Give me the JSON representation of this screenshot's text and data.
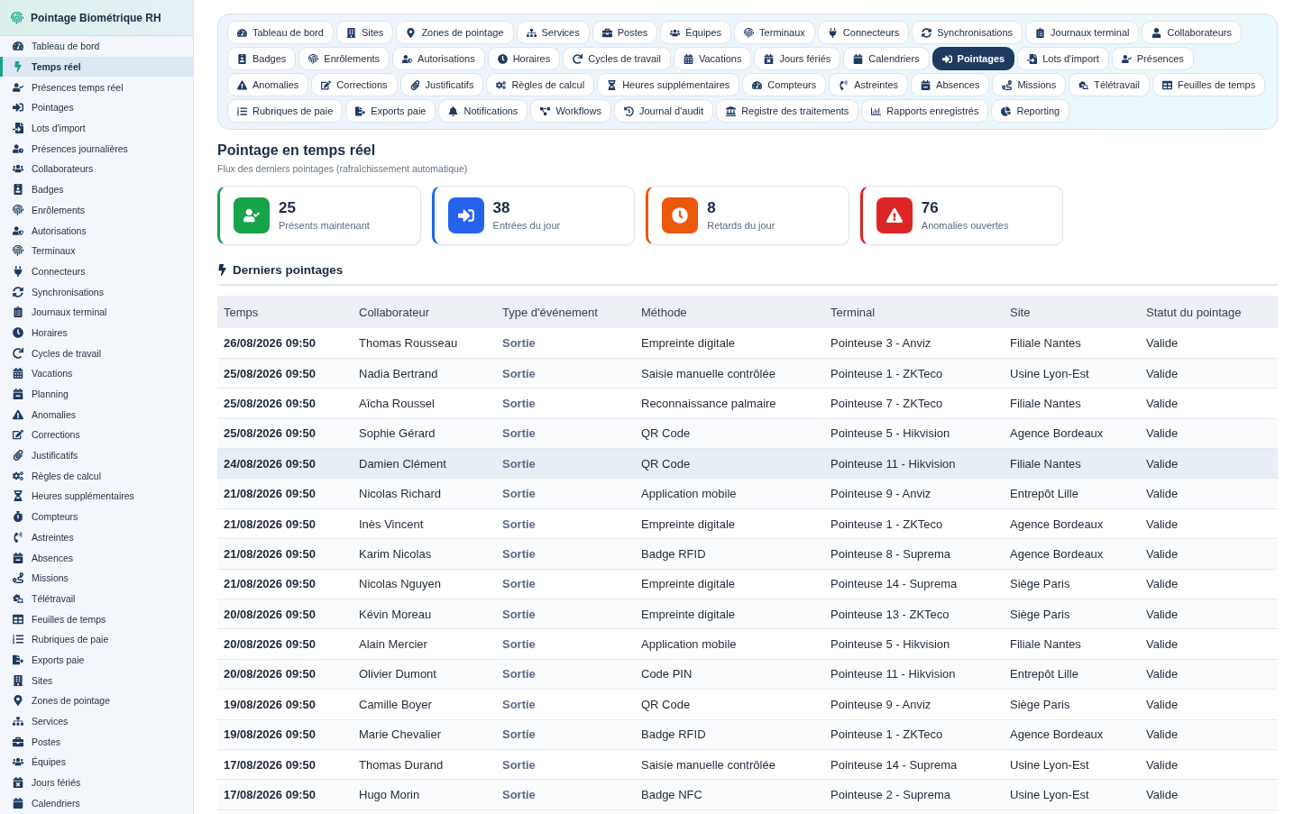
{
  "sidebar": {
    "title": "Pointage Biométrique RH",
    "items": [
      {
        "label": "Tableau de bord",
        "selected": false
      },
      {
        "label": "Temps réel",
        "selected": true
      },
      {
        "label": "Présences temps réel",
        "selected": false
      },
      {
        "label": "Pointages",
        "selected": false
      },
      {
        "label": "Lots d'import",
        "selected": false
      },
      {
        "label": "Présences journalières",
        "selected": false
      },
      {
        "label": "Collaborateurs",
        "selected": false
      },
      {
        "label": "Badges",
        "selected": false
      },
      {
        "label": "Enrôlements",
        "selected": false
      },
      {
        "label": "Autorisations",
        "selected": false
      },
      {
        "label": "Terminaux",
        "selected": false
      },
      {
        "label": "Connecteurs",
        "selected": false
      },
      {
        "label": "Synchronisations",
        "selected": false
      },
      {
        "label": "Journaux terminal",
        "selected": false
      },
      {
        "label": "Horaires",
        "selected": false
      },
      {
        "label": "Cycles de travail",
        "selected": false
      },
      {
        "label": "Vacations",
        "selected": false
      },
      {
        "label": "Planning",
        "selected": false
      },
      {
        "label": "Anomalies",
        "selected": false
      },
      {
        "label": "Corrections",
        "selected": false
      },
      {
        "label": "Justificatifs",
        "selected": false
      },
      {
        "label": "Règles de calcul",
        "selected": false
      },
      {
        "label": "Heures supplémentaires",
        "selected": false
      },
      {
        "label": "Compteurs",
        "selected": false
      },
      {
        "label": "Astreintes",
        "selected": false
      },
      {
        "label": "Absences",
        "selected": false
      },
      {
        "label": "Missions",
        "selected": false
      },
      {
        "label": "Télétravail",
        "selected": false
      },
      {
        "label": "Feuilles de temps",
        "selected": false
      },
      {
        "label": "Rubriques de paie",
        "selected": false
      },
      {
        "label": "Exports paie",
        "selected": false
      },
      {
        "label": "Sites",
        "selected": false
      },
      {
        "label": "Zones de pointage",
        "selected": false
      },
      {
        "label": "Services",
        "selected": false
      },
      {
        "label": "Postes",
        "selected": false
      },
      {
        "label": "Équipes",
        "selected": false
      },
      {
        "label": "Jours fériés",
        "selected": false
      },
      {
        "label": "Calendriers",
        "selected": false
      }
    ]
  },
  "module_tabs": [
    {
      "label": "Tableau de bord",
      "selected": false
    },
    {
      "label": "Sites",
      "selected": false
    },
    {
      "label": "Zones de pointage",
      "selected": false
    },
    {
      "label": "Services",
      "selected": false
    },
    {
      "label": "Postes",
      "selected": false
    },
    {
      "label": "Équipes",
      "selected": false
    },
    {
      "label": "Terminaux",
      "selected": false
    },
    {
      "label": "Connecteurs",
      "selected": false
    },
    {
      "label": "Synchronisations",
      "selected": false
    },
    {
      "label": "Journaux terminal",
      "selected": false
    },
    {
      "label": "Collaborateurs",
      "selected": false
    },
    {
      "label": "Badges",
      "selected": false
    },
    {
      "label": "Enrôlements",
      "selected": false
    },
    {
      "label": "Autorisations",
      "selected": false
    },
    {
      "label": "Horaires",
      "selected": false
    },
    {
      "label": "Cycles de travail",
      "selected": false
    },
    {
      "label": "Vacations",
      "selected": false
    },
    {
      "label": "Jours fériés",
      "selected": false
    },
    {
      "label": "Calendriers",
      "selected": false
    },
    {
      "label": "Pointages",
      "selected": true
    },
    {
      "label": "Lots d'import",
      "selected": false
    },
    {
      "label": "Présences",
      "selected": false
    },
    {
      "label": "Anomalies",
      "selected": false
    },
    {
      "label": "Corrections",
      "selected": false
    },
    {
      "label": "Justificatifs",
      "selected": false
    },
    {
      "label": "Règles de calcul",
      "selected": false
    },
    {
      "label": "Heures supplémentaires",
      "selected": false
    },
    {
      "label": "Compteurs",
      "selected": false
    },
    {
      "label": "Astreintes",
      "selected": false
    },
    {
      "label": "Absences",
      "selected": false
    },
    {
      "label": "Missions",
      "selected": false
    },
    {
      "label": "Télétravail",
      "selected": false
    },
    {
      "label": "Feuilles de temps",
      "selected": false
    },
    {
      "label": "Rubriques de paie",
      "selected": false
    },
    {
      "label": "Exports paie",
      "selected": false
    },
    {
      "label": "Notifications",
      "selected": false
    },
    {
      "label": "Workflows",
      "selected": false
    },
    {
      "label": "Journal d'audit",
      "selected": false
    },
    {
      "label": "Registre des traitements",
      "selected": false
    },
    {
      "label": "Rapports enregistrés",
      "selected": false
    },
    {
      "label": "Reporting",
      "selected": false
    }
  ],
  "page": {
    "title": "Pointage en temps réel",
    "subtitle": "Flux des derniers pointages (rafraîchissement automatique)"
  },
  "stat_cards": [
    {
      "value": "25",
      "label": "Présents maintenant",
      "color": "#16a34a"
    },
    {
      "value": "38",
      "label": "Entrées du jour",
      "color": "#2563eb"
    },
    {
      "value": "8",
      "label": "Retards du jour",
      "color": "#ea580c"
    },
    {
      "value": "76",
      "label": "Anomalies ouvertes",
      "color": "#dc2626"
    }
  ],
  "section_title": "Derniers pointages",
  "table": {
    "columns": [
      "Temps",
      "Collaborateur",
      "Type d'événement",
      "Méthode",
      "Terminal",
      "Site",
      "Statut du pointage"
    ],
    "rows": [
      {
        "time": "26/08/2026 09:50",
        "employee": "Thomas Rousseau",
        "event_type": "Sortie",
        "method": "Empreinte digitale",
        "terminal": "Pointeuse 3 - Anviz",
        "site": "Filiale Nantes",
        "status": "Valide",
        "highlighted": false
      },
      {
        "time": "25/08/2026 09:50",
        "employee": "Nadia Bertrand",
        "event_type": "Sortie",
        "method": "Saisie manuelle contrôlée",
        "terminal": "Pointeuse 1 - ZKTeco",
        "site": "Usine Lyon-Est",
        "status": "Valide",
        "highlighted": false
      },
      {
        "time": "25/08/2026 09:50",
        "employee": "Aïcha Roussel",
        "event_type": "Sortie",
        "method": "Reconnaissance palmaire",
        "terminal": "Pointeuse 7 - ZKTeco",
        "site": "Filiale Nantes",
        "status": "Valide",
        "highlighted": false
      },
      {
        "time": "25/08/2026 09:50",
        "employee": "Sophie Gérard",
        "event_type": "Sortie",
        "method": "QR Code",
        "terminal": "Pointeuse 5 - Hikvision",
        "site": "Agence Bordeaux",
        "status": "Valide",
        "highlighted": false
      },
      {
        "time": "24/08/2026 09:50",
        "employee": "Damien Clément",
        "event_type": "Sortie",
        "method": "QR Code",
        "terminal": "Pointeuse 11 - Hikvision",
        "site": "Filiale Nantes",
        "status": "Valide",
        "highlighted": true
      },
      {
        "time": "21/08/2026 09:50",
        "employee": "Nicolas Richard",
        "event_type": "Sortie",
        "method": "Application mobile",
        "terminal": "Pointeuse 9 - Anviz",
        "site": "Entrepôt Lille",
        "status": "Valide",
        "highlighted": false
      },
      {
        "time": "21/08/2026 09:50",
        "employee": "Inès Vincent",
        "event_type": "Sortie",
        "method": "Empreinte digitale",
        "terminal": "Pointeuse 1 - ZKTeco",
        "site": "Agence Bordeaux",
        "status": "Valide",
        "highlighted": false
      },
      {
        "time": "21/08/2026 09:50",
        "employee": "Karim Nicolas",
        "event_type": "Sortie",
        "method": "Badge RFID",
        "terminal": "Pointeuse 8 - Suprema",
        "site": "Agence Bordeaux",
        "status": "Valide",
        "highlighted": false
      },
      {
        "time": "21/08/2026 09:50",
        "employee": "Nicolas Nguyen",
        "event_type": "Sortie",
        "method": "Empreinte digitale",
        "terminal": "Pointeuse 14 - Suprema",
        "site": "Siège Paris",
        "status": "Valide",
        "highlighted": false
      },
      {
        "time": "20/08/2026 09:50",
        "employee": "Kévin Moreau",
        "event_type": "Sortie",
        "method": "Empreinte digitale",
        "terminal": "Pointeuse 13 - ZKTeco",
        "site": "Siège Paris",
        "status": "Valide",
        "highlighted": false
      },
      {
        "time": "20/08/2026 09:50",
        "employee": "Alain Mercier",
        "event_type": "Sortie",
        "method": "Application mobile",
        "terminal": "Pointeuse 5 - Hikvision",
        "site": "Filiale Nantes",
        "status": "Valide",
        "highlighted": false
      },
      {
        "time": "20/08/2026 09:50",
        "employee": "Olivier Dumont",
        "event_type": "Sortie",
        "method": "Code PIN",
        "terminal": "Pointeuse 11 - Hikvision",
        "site": "Entrepôt Lille",
        "status": "Valide",
        "highlighted": false
      },
      {
        "time": "19/08/2026 09:50",
        "employee": "Camille Boyer",
        "event_type": "Sortie",
        "method": "QR Code",
        "terminal": "Pointeuse 9 - Anviz",
        "site": "Siège Paris",
        "status": "Valide",
        "highlighted": false
      },
      {
        "time": "19/08/2026 09:50",
        "employee": "Marie Chevalier",
        "event_type": "Sortie",
        "method": "Badge RFID",
        "terminal": "Pointeuse 1 - ZKTeco",
        "site": "Agence Bordeaux",
        "status": "Valide",
        "highlighted": false
      },
      {
        "time": "17/08/2026 09:50",
        "employee": "Thomas Durand",
        "event_type": "Sortie",
        "method": "Saisie manuelle contrôlée",
        "terminal": "Pointeuse 14 - Suprema",
        "site": "Usine Lyon-Est",
        "status": "Valide",
        "highlighted": false
      },
      {
        "time": "17/08/2026 09:50",
        "employee": "Hugo Morin",
        "event_type": "Sortie",
        "method": "Badge NFC",
        "terminal": "Pointeuse 2 - Suprema",
        "site": "Usine Lyon-Est",
        "status": "Valide",
        "highlighted": false
      }
    ]
  }
}
